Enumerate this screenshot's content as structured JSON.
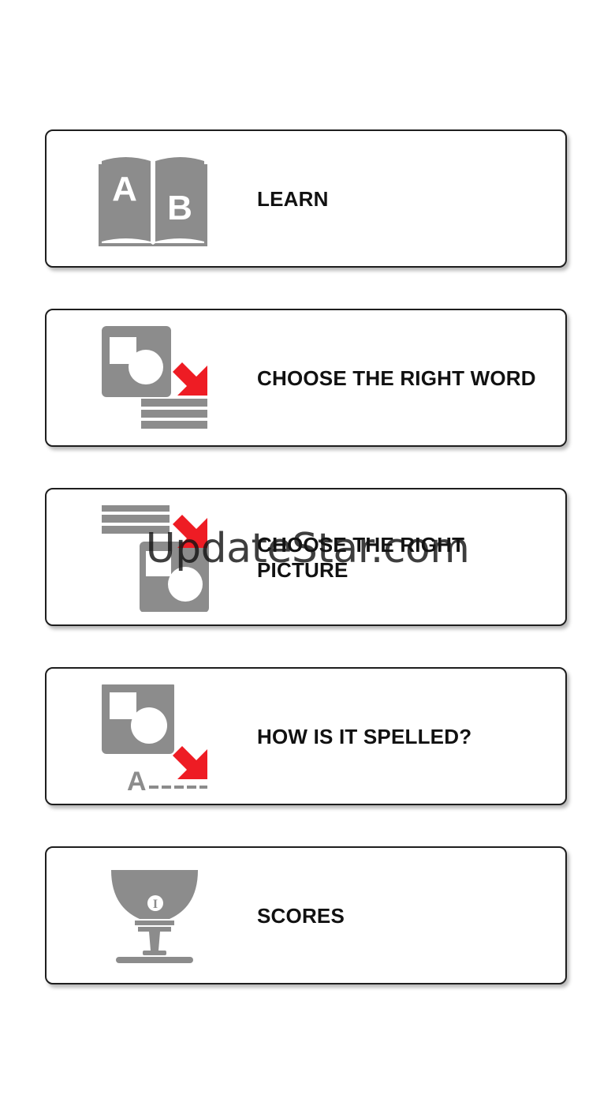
{
  "menu": {
    "items": [
      {
        "id": "learn",
        "label": "LEARN",
        "icon": "book-ab-icon"
      },
      {
        "id": "choose-word",
        "label": "CHOOSE THE RIGHT WORD",
        "icon": "picture-to-word-icon"
      },
      {
        "id": "choose-picture",
        "label": "CHOOSE THE RIGHT PICTURE",
        "icon": "word-to-picture-icon"
      },
      {
        "id": "spelling",
        "label": "HOW IS IT SPELLED?",
        "icon": "spelling-icon"
      },
      {
        "id": "scores",
        "label": "SCORES",
        "icon": "trophy-cup-icon"
      }
    ]
  },
  "icon_text": {
    "book_left_letter": "A",
    "book_right_letter": "B",
    "spell_letter": "A",
    "trophy_numeral": "I"
  },
  "watermark": {
    "text": "UpdateStar.com"
  },
  "colors": {
    "icon_gray": "#8c8c8c",
    "arrow_red": "#ee1c24",
    "card_border": "#1e1e1e",
    "label_text": "#111111"
  }
}
